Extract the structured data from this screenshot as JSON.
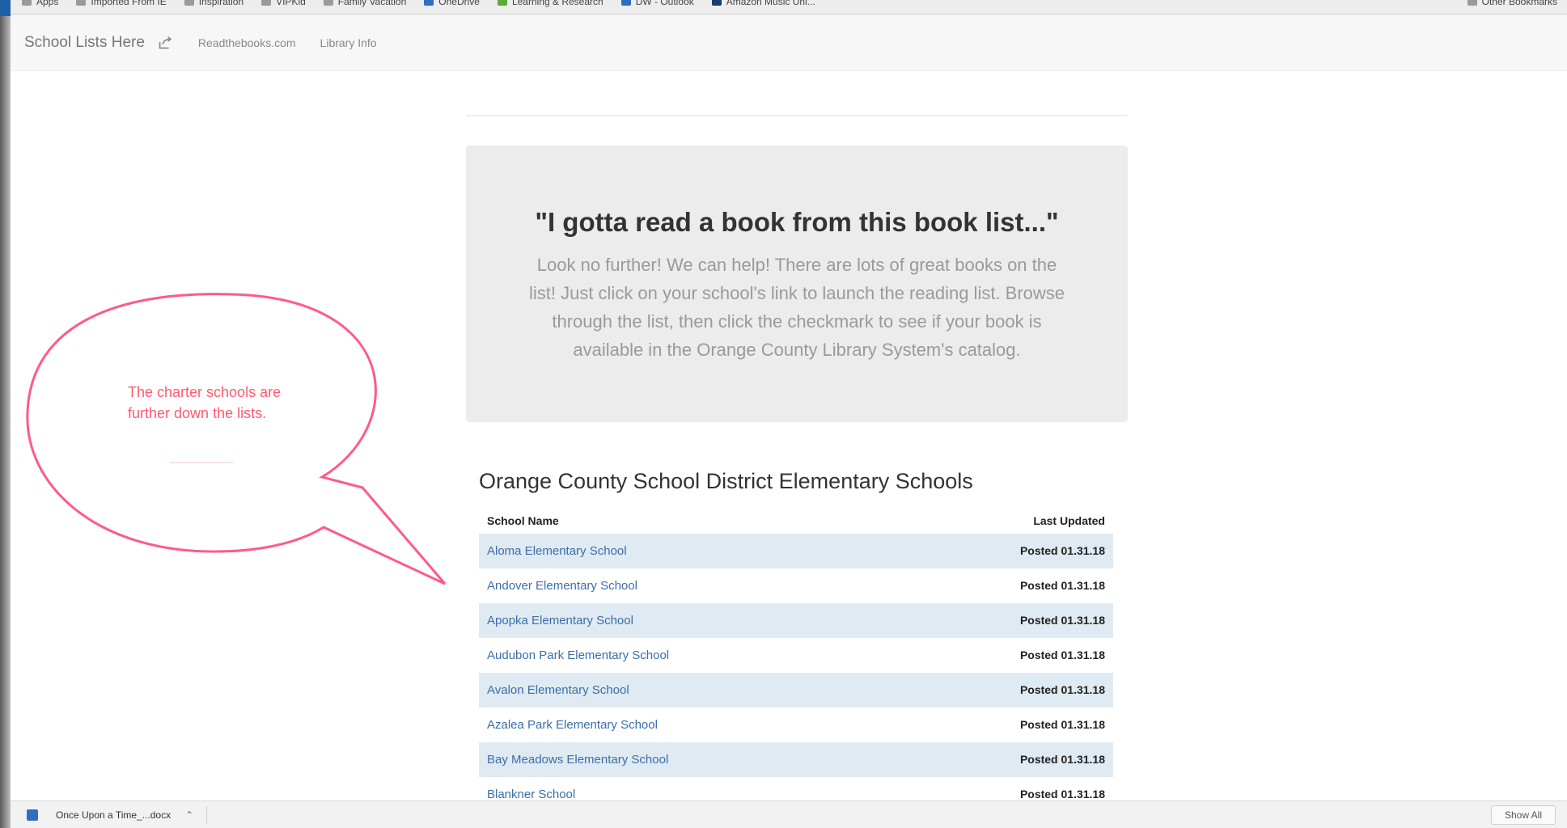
{
  "browser": {
    "bookmarks": [
      {
        "label": "Apps",
        "icon": "apps-icon"
      },
      {
        "label": "Imported From IE",
        "icon": "folder-icon"
      },
      {
        "label": "Inspiration",
        "icon": "folder-icon"
      },
      {
        "label": "VIPKid",
        "icon": "folder-icon"
      },
      {
        "label": "Family Vacation",
        "icon": "folder-icon"
      },
      {
        "label": "OneDrive",
        "icon": "cloud-icon"
      },
      {
        "label": "Learning & Research",
        "icon": "leaf-icon"
      },
      {
        "label": "DW - Outlook",
        "icon": "mail-icon"
      },
      {
        "label": "Amazon Music Unl...",
        "icon": "music-icon"
      }
    ],
    "bookmarks_right": "Other Bookmarks"
  },
  "site_nav": {
    "brand": "School Lists Here",
    "links": [
      "Readthebooks.com",
      "Library Info"
    ]
  },
  "hero": {
    "title": "\"I gotta read a book from this book list...\"",
    "text": "Look no further! We can help! There are lots of great books on the list! Just click on your school's link to launch the reading list. Browse through the list, then click the checkmark to see if your book is available in the Orange County Library System's catalog."
  },
  "annotation": {
    "text": "The charter schools are further down the lists.",
    "color": "#ff5a8a"
  },
  "schools": {
    "title": "Orange County School District Elementary Schools",
    "headers": {
      "name": "School Name",
      "updated": "Last Updated"
    },
    "rows": [
      {
        "name": "Aloma Elementary School",
        "updated": "Posted 01.31.18"
      },
      {
        "name": "Andover Elementary School",
        "updated": "Posted 01.31.18"
      },
      {
        "name": "Apopka Elementary School",
        "updated": "Posted 01.31.18"
      },
      {
        "name": "Audubon Park Elementary School",
        "updated": "Posted 01.31.18"
      },
      {
        "name": "Avalon Elementary School",
        "updated": "Posted 01.31.18"
      },
      {
        "name": "Azalea Park Elementary School",
        "updated": "Posted 01.31.18"
      },
      {
        "name": "Bay Meadows Elementary School",
        "updated": "Posted 01.31.18"
      },
      {
        "name": "Blankner School",
        "updated": "Posted 01.31.18"
      }
    ]
  },
  "downloads": {
    "file_name": "Once Upon a Time_...docx",
    "show_all": "Show All"
  },
  "colors": {
    "link": "#3c6ea8",
    "row_stripe": "#dfeaf2",
    "hero_bg": "#ececec"
  }
}
